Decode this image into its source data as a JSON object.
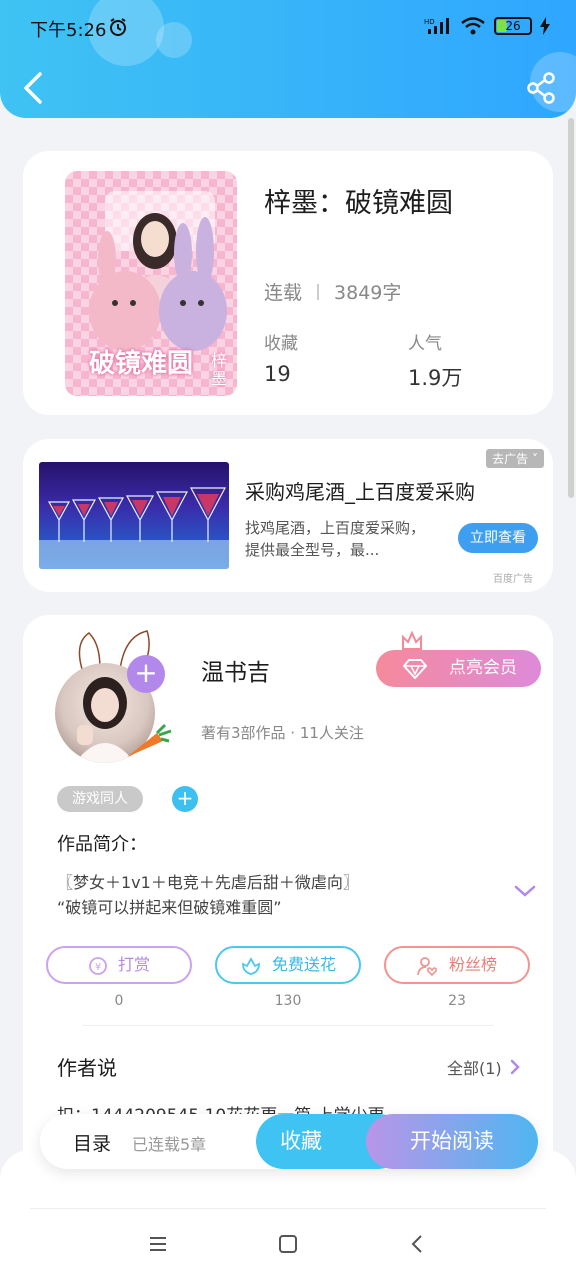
{
  "status_bar": {
    "time": "下午5:26",
    "battery": "26",
    "signal": "HD"
  },
  "header": {
    "back_icon": "chevron-left-icon",
    "share_icon": "share-icon"
  },
  "book": {
    "cover_title": "破镜难圆",
    "cover_author": "梓墨",
    "title": "梓墨：破镜难圆",
    "status": "连载",
    "word_count": "3849字",
    "favorites_label": "收藏",
    "favorites_value": "19",
    "popularity_label": "人气",
    "popularity_value": "1.9万"
  },
  "ad": {
    "tag": "去广告",
    "title": "采购鸡尾酒_上百度爱采购",
    "desc": "找鸡尾酒，上百度爱采购，提供最全型号，最...",
    "button": "立即查看",
    "source": "百度广告"
  },
  "author": {
    "name": "温书吉",
    "meta": "著有3部作品 · 11人关注",
    "vip_button": "点亮会员",
    "tag": "游戏同人",
    "intro_title": "作品简介：",
    "intro_line1": "〖梦女＋1v1＋电竞＋先虐后甜＋微虐向〗",
    "intro_line2": "“破镜可以拼起来但破镜难重圆”",
    "actions": [
      {
        "label": "打赏",
        "count": "0",
        "color": "#c9a3ee"
      },
      {
        "label": "免费送花",
        "count": "130",
        "color": "#4cc8ee"
      },
      {
        "label": "粉丝榜",
        "count": "23",
        "color": "#f0958f"
      }
    ],
    "author_says_title": "作者说",
    "all_link": "全部(1)",
    "message": "扣：1444209545 10花花更一篇 上学少更"
  },
  "bottom_bar": {
    "toc": "目录",
    "toc_sub": "已连载5章",
    "favorite": "收藏",
    "read": "开始阅读"
  },
  "colors": {
    "accent": "#2fa6ff",
    "purple": "#b388eb",
    "vip": "#f68a9c"
  }
}
